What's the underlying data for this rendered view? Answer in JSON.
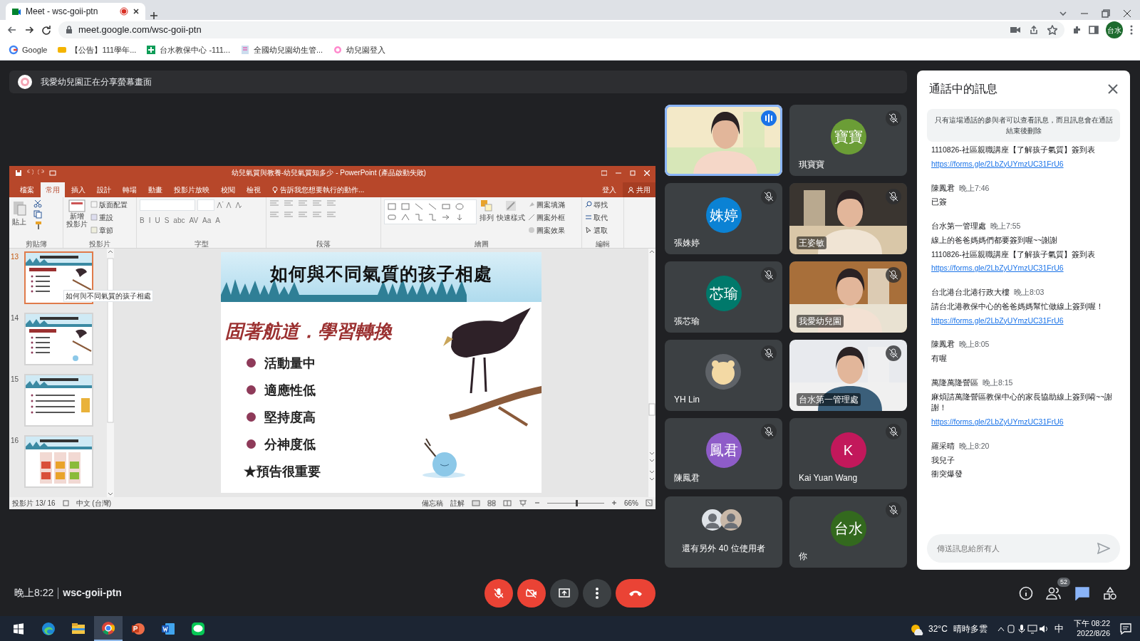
{
  "browser": {
    "tab": {
      "title": "Meet - wsc-goii-ptn",
      "recording": true
    },
    "address": "meet.google.com/wsc-goii-ptn",
    "profile": "台水",
    "bookmarks": [
      {
        "label": "Google"
      },
      {
        "label": "【公告】111學年..."
      },
      {
        "label": "台水教保中心 -111..."
      },
      {
        "label": "全國幼兒園幼生管..."
      },
      {
        "label": "幼兒園登入"
      }
    ]
  },
  "presenting_banner": "我愛幼兒園正在分享螢幕畫面",
  "powerpoint": {
    "title": "幼兒氣質與教養-幼兒氣質知多少 - PowerPoint (產品啟動失敗)",
    "tabs": [
      {
        "label": "檔案",
        "selected": false
      },
      {
        "label": "常用",
        "selected": true
      },
      {
        "label": "插入",
        "selected": false
      },
      {
        "label": "設計",
        "selected": false
      },
      {
        "label": "轉場",
        "selected": false
      },
      {
        "label": "動畫",
        "selected": false
      },
      {
        "label": "投影片放映",
        "selected": false
      },
      {
        "label": "校閱",
        "selected": false
      },
      {
        "label": "檢視",
        "selected": false
      }
    ],
    "tell_me": "告訴我您想要執行的動作...",
    "sign_in": "登入",
    "share": "共用",
    "ribbon": [
      {
        "kind": "clipboard",
        "label": "剪貼簿",
        "items": [
          "貼上"
        ]
      },
      {
        "kind": "slides",
        "label": "投影片",
        "items": [
          "新增",
          "投影片",
          "版面配置",
          "重設",
          "章節"
        ]
      },
      {
        "kind": "font",
        "label": "字型",
        "items": [
          "B",
          "I",
          "U",
          "S",
          "abc",
          "AV",
          "Aa",
          "A"
        ]
      },
      {
        "kind": "paragraph",
        "label": "段落"
      },
      {
        "kind": "drawing",
        "label": "繪圖",
        "items": [
          "排列",
          "快速樣式",
          "圖案填滿",
          "圖案外框",
          "圖案效果"
        ]
      },
      {
        "kind": "editing",
        "label": "編輯",
        "items": [
          "尋找",
          "取代",
          "選取"
        ]
      }
    ],
    "thumbnails": [
      {
        "number": "13",
        "selected": true
      },
      {
        "number": "14",
        "selected": false
      },
      {
        "number": "15",
        "selected": false
      },
      {
        "number": "16",
        "selected": false
      }
    ],
    "tooltip": "如何與不同氣質的孩子相處",
    "slide": {
      "title": "如何與不同氣質的孩子相處",
      "subtitle": "固著航道．學習轉換",
      "bullets": [
        "活動量中",
        "適應性低",
        "堅持度高",
        "分神度低"
      ],
      "note": "★預告很重要"
    },
    "status": {
      "slide_counter": "投影片 13/ 16",
      "language": "中文 (台灣)",
      "notes": "備忘稿",
      "comments": "註解",
      "zoom": "66%",
      "level": 0.5
    }
  },
  "tiles": [
    {
      "kind": "video",
      "muted": false,
      "speaking": true
    },
    {
      "kind": "initials",
      "initials": "寶寶",
      "color": "#6b9d36",
      "name": "琪寶寶",
      "muted": true,
      "speaking": false
    },
    {
      "kind": "initials",
      "initials": "姝婷",
      "color": "#0b82d4",
      "name": "張姝婷",
      "muted": true,
      "speaking": false
    },
    {
      "kind": "video",
      "name": "王姿敏",
      "muted": true,
      "speaking": false
    },
    {
      "kind": "initials",
      "initials": "芯瑜",
      "color": "#00796b",
      "name": "張芯瑜",
      "muted": true,
      "speaking": false
    },
    {
      "kind": "video",
      "name": "我愛幼兒園",
      "muted": true,
      "speaking": false
    },
    {
      "name": "YH Lin",
      "muted": true,
      "speaking": false
    },
    {
      "kind": "video",
      "name": "台水第一管理處",
      "muted": true,
      "speaking": false
    },
    {
      "kind": "initials",
      "initials": "鳳君",
      "color": "#8e5cc8",
      "name": "陳鳳君",
      "muted": true,
      "speaking": false
    },
    {
      "kind": "initials",
      "initials": "K",
      "color": "#c2185b",
      "name": "Kai Yuan Wang",
      "muted": true,
      "speaking": false
    },
    {
      "kind": "more",
      "name": "還有另外 40 位使用者"
    },
    {
      "kind": "initials",
      "initials": "台水",
      "color": "#33691e",
      "name": "你",
      "muted": true,
      "speaking": false
    }
  ],
  "chat": {
    "title": "通話中的訊息",
    "notice": "只有這場通話的參與者可以查看訊息，而且訊息會在通話結束後刪除",
    "messages": [
      {
        "lines": [
          {
            "kind": "text",
            "text": "1110826-社區親職講座【了解孩子氣質】簽到表"
          },
          {
            "kind": "link",
            "text": "https://forms.gle/2LbZyUYmzUC31FrU6"
          }
        ]
      },
      {
        "sender": "陳鳳君",
        "time": "晚上7:46",
        "lines": [
          {
            "kind": "text",
            "text": "已簽"
          }
        ]
      },
      {
        "sender": "台水第一管理處",
        "time": "晚上7:55",
        "lines": [
          {
            "kind": "text",
            "text": "線上的爸爸媽媽們都要簽到喔~~謝謝"
          },
          {
            "kind": "text",
            "text": "1110826-社區親職講座【了解孩子氣質】簽到表"
          },
          {
            "kind": "link",
            "text": "https://forms.gle/2LbZyUYmzUC31FrU6"
          }
        ]
      },
      {
        "sender": "台北港台北港行政大樓",
        "time": "晚上8:03",
        "lines": [
          {
            "kind": "text",
            "text": "請台北港教保中心的爸爸媽媽幫忙做線上簽到喔！"
          },
          {
            "kind": "link",
            "text": "https://forms.gle/2LbZyUYmzUC31FrU6"
          }
        ]
      },
      {
        "sender": "陳鳳君",
        "time": "晚上8:05",
        "lines": [
          {
            "kind": "text",
            "text": "有喔"
          }
        ]
      },
      {
        "sender": "萬隆萬隆營區",
        "time": "晚上8:15",
        "lines": [
          {
            "kind": "text",
            "text": "麻煩請萬隆營區教保中心的家長協助線上簽到嗬~~謝謝！"
          },
          {
            "kind": "link",
            "text": "https://forms.gle/2LbZyUYmzUC31FrU6"
          }
        ]
      },
      {
        "sender": "羅采晴",
        "time": "晚上8:20",
        "lines": [
          {
            "kind": "text",
            "text": "我兒子"
          },
          {
            "kind": "text",
            "text": "衝突爆發"
          }
        ]
      }
    ],
    "placeholder": "傳送訊息給所有人"
  },
  "controls": {
    "time": "晚上8:22",
    "meeting_code": "wsc-goii-ptn",
    "mic_on": false,
    "camera_on": false,
    "people_count": "52",
    "chat_selected": true
  },
  "taskbar": {
    "apps": [
      {
        "kind": "edge",
        "selected": false
      },
      {
        "kind": "explorer",
        "selected": false
      },
      {
        "kind": "chrome",
        "selected": true
      },
      {
        "kind": "powerpoint",
        "selected": false
      },
      {
        "kind": "word",
        "selected": false
      },
      {
        "kind": "line",
        "selected": false
      }
    ],
    "temperature": "32°C",
    "weather": "晴時多雲",
    "ime": "中",
    "time": "下午 08:22",
    "date": "2022/8/26"
  }
}
